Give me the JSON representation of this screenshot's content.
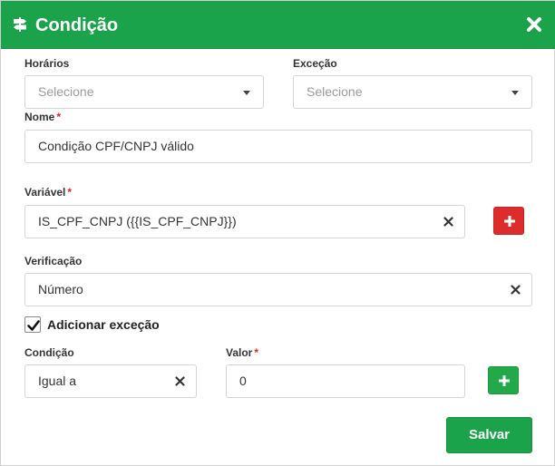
{
  "dialog": {
    "title": "Condição",
    "title_icon": "signpost-icon",
    "close_icon": "close-icon"
  },
  "fields": {
    "horarios": {
      "label": "Horários",
      "placeholder": "Selecione"
    },
    "excecao": {
      "label": "Exceção",
      "placeholder": "Selecione"
    },
    "nome": {
      "label": "Nome",
      "required_mark": "*",
      "value": "Condição CPF/CNPJ válido"
    },
    "variavel": {
      "label": "Variável",
      "required_mark": "*",
      "value": "IS_CPF_CNPJ ({{IS_CPF_CNPJ}})"
    },
    "verificacao": {
      "label": "Verificação",
      "value": "Número"
    },
    "adicionar_excecao": {
      "label": "Adicionar exceção",
      "checked": true
    },
    "condicao": {
      "label": "Condição",
      "value": "Igual a"
    },
    "valor": {
      "label": "Valor",
      "required_mark": "*",
      "value": "0"
    }
  },
  "buttons": {
    "add_variable_icon": "plus-icon",
    "add_condition_icon": "plus-icon",
    "save_label": "Salvar"
  },
  "colors": {
    "header": "#1aa34a",
    "danger": "#dd2c2c",
    "success": "#22a94a",
    "required": "#e02424"
  }
}
